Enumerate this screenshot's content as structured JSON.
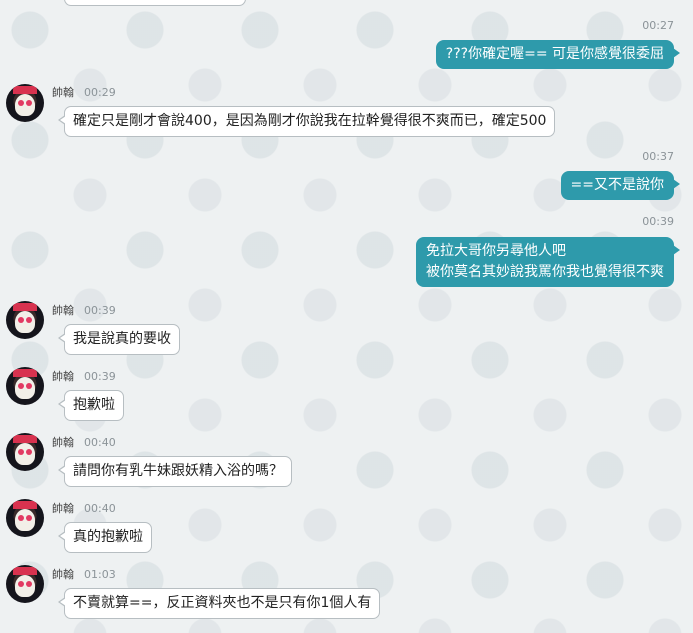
{
  "messages_outgoing": [
    {
      "time": "00:27",
      "text": "???你確定喔==  可是你感覺很委屈"
    },
    {
      "time": "00:37",
      "text": "==又不是說你"
    },
    {
      "time": "00:39",
      "lines": [
        "免拉大哥你另尋他人吧",
        "被你莫名其妙說我罵你我也覺得很不爽"
      ]
    }
  ],
  "messages_incoming": [
    {
      "sender": "帥翰",
      "time": "00:29",
      "text": "確定只是剛才會說400，是因為剛才你說我在拉幹覺得很不爽而已，確定500"
    },
    {
      "sender": "帥翰",
      "time": "00:39",
      "text": "我是說真的要收"
    },
    {
      "sender": "帥翰",
      "time": "00:39",
      "text": "抱歉啦"
    },
    {
      "sender": "帥翰",
      "time": "00:40",
      "text": "請問你有乳牛妹跟妖精入浴的嗎？"
    },
    {
      "sender": "帥翰",
      "time": "00:40",
      "text": "真的抱歉啦"
    },
    {
      "sender": "帥翰",
      "time": "01:03",
      "text": "不賣就算==，反正資料夾也不是只有你1個人有"
    }
  ],
  "colors": {
    "background": "#eef1f2",
    "outgoing_bubble": "#2e9aab",
    "incoming_bubble": "#ffffff"
  }
}
